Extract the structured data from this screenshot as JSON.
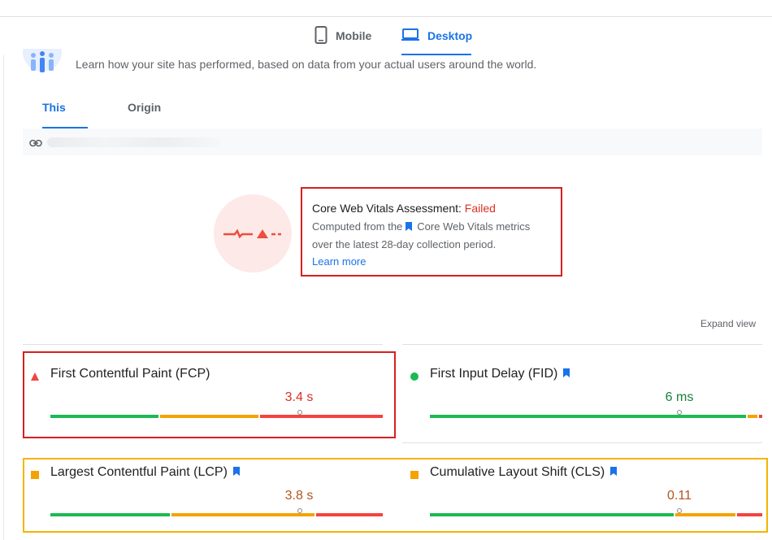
{
  "device_tabs": {
    "mobile": "Mobile",
    "desktop": "Desktop",
    "active": "desktop"
  },
  "intro_text": "Learn how your site has performed, based on data from your actual users around the world.",
  "url_tabs": {
    "this_url": "This URL",
    "origin": "Origin",
    "active": "this_url"
  },
  "assessment": {
    "title": "Core Web Vitals Assessment:",
    "status": "Failed",
    "desc_prefix": "Computed from the",
    "desc_link": "Core Web Vitals metrics",
    "desc_suffix": "over the latest 28-day collection period.",
    "learn_more": "Learn more"
  },
  "expand_view": "Expand view",
  "colors": {
    "good": "#1db954",
    "needs_improvement": "#f4a300",
    "poor": "#f4433f",
    "accent": "#1a73e8",
    "failed": "#d93025"
  },
  "metrics": [
    {
      "id": "fcp",
      "label": "First Contentful Paint (FCP)",
      "value": "3.4 s",
      "rating": "poor",
      "core_vital": false,
      "marker_fraction": 0.75
    },
    {
      "id": "fid",
      "label": "First Input Delay (FID)",
      "value": "6 ms",
      "rating": "good",
      "core_vital": true,
      "marker_fraction": 0.75
    },
    {
      "id": "lcp",
      "label": "Largest Contentful Paint (LCP)",
      "value": "3.8 s",
      "rating": "needs_improvement",
      "core_vital": true,
      "marker_fraction": 0.75
    },
    {
      "id": "cls",
      "label": "Cumulative Layout Shift (CLS)",
      "value": "0.11",
      "rating": "needs_improvement",
      "core_vital": true,
      "marker_fraction": 0.75
    }
  ]
}
